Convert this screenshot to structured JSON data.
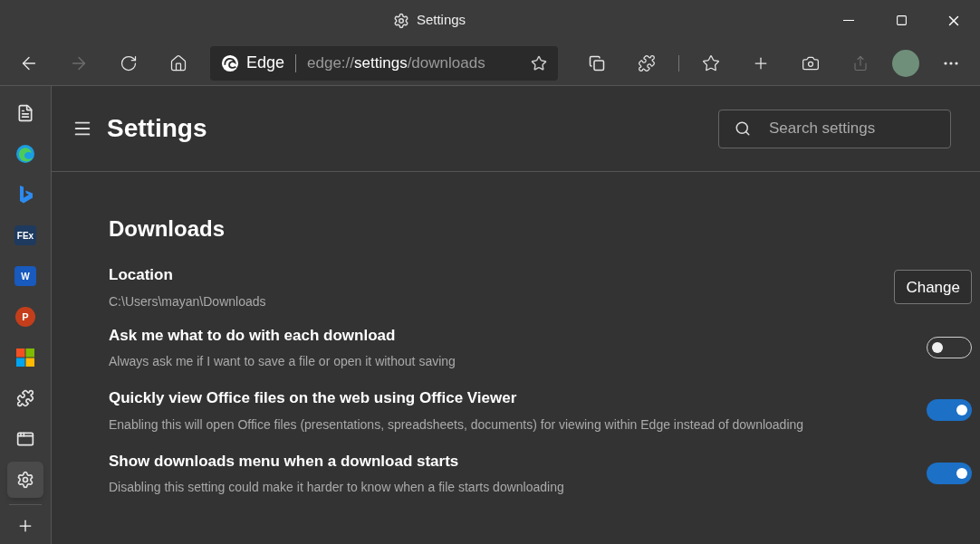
{
  "window": {
    "title": "Settings"
  },
  "address_bar": {
    "site_label": "Edge",
    "url_segments": [
      {
        "text": "edge://",
        "highlight": false
      },
      {
        "text": "settings",
        "highlight": true
      },
      {
        "text": "/downloads",
        "highlight": false
      }
    ]
  },
  "toolbar": {
    "back_disabled": false,
    "forward_disabled": true,
    "share_disabled": true
  },
  "sidebar": {
    "items": [
      {
        "kind": "page",
        "selected": false
      },
      {
        "kind": "edge",
        "selected": false
      },
      {
        "kind": "bing",
        "selected": false
      },
      {
        "kind": "tile",
        "label": "FEx",
        "color": "#1e3a5f",
        "selected": false
      },
      {
        "kind": "tile",
        "label": "W",
        "color": "#185abd",
        "selected": false
      },
      {
        "kind": "round",
        "label": "P",
        "color": "#c43e1c",
        "selected": false
      },
      {
        "kind": "windows",
        "selected": false
      },
      {
        "kind": "puzzle",
        "selected": false
      },
      {
        "kind": "apps",
        "selected": false
      },
      {
        "kind": "gear",
        "selected": true
      }
    ]
  },
  "settings": {
    "title": "Settings",
    "search": {
      "placeholder": "Search settings"
    },
    "section_title": "Downloads",
    "location": {
      "label": "Location",
      "path": "C:\\Users\\mayan\\Downloads",
      "button": "Change"
    },
    "options": [
      {
        "label": "Ask me what to do with each download",
        "description": "Always ask me if I want to save a file or open it without saving",
        "on": false
      },
      {
        "label": "Quickly view Office files on the web using Office Viewer",
        "description": "Enabling this will open Office files (presentations, spreadsheets, documents) for viewing within Edge instead of downloading",
        "on": true
      },
      {
        "label": "Show downloads menu when a download starts",
        "description": "Disabling this setting could make it harder to know when a file starts downloading",
        "on": true
      }
    ]
  }
}
